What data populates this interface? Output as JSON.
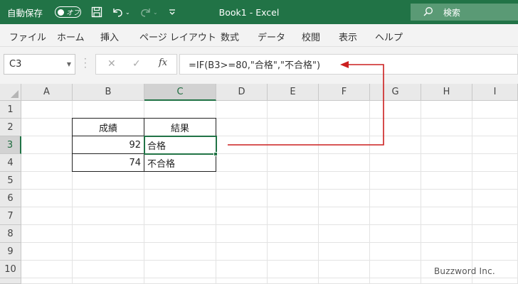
{
  "titlebar": {
    "autosave_label": "自動保存",
    "autosave_state": "オフ",
    "title": "Book1  -  Excel",
    "search_placeholder": "検索",
    "icons": [
      "save-icon",
      "undo-icon",
      "redo-icon",
      "customize-qat-icon",
      "search-icon"
    ]
  },
  "ribbon": {
    "tabs": [
      "ファイル",
      "ホーム",
      "挿入",
      "ページ レイアウト",
      "数式",
      "データ",
      "校閲",
      "表示",
      "ヘルプ"
    ]
  },
  "formula_bar": {
    "name_box": "C3",
    "cancel_glyph": "✕",
    "enter_glyph": "✓",
    "fx_label": "fx",
    "formula": "=IF(B3>=80,\"合格\",\"不合格\")"
  },
  "grid": {
    "columns": [
      "A",
      "B",
      "C",
      "D",
      "E",
      "F",
      "G",
      "H",
      "I"
    ],
    "rows": [
      "1",
      "2",
      "3",
      "4",
      "5",
      "6",
      "7",
      "8",
      "9",
      "10"
    ],
    "selected_column": "C",
    "selected_row": "3",
    "table": {
      "headers": [
        "成績",
        "結果"
      ],
      "rows": [
        {
          "score": "92",
          "result": "合格"
        },
        {
          "score": "74",
          "result": "不合格"
        }
      ]
    }
  },
  "annotation": {
    "arrow_color": "#cc1f1f"
  },
  "watermark": "Buzzword Inc.",
  "colors": {
    "excel_green": "#217346",
    "ribbon_bg": "#f3f3f3"
  }
}
